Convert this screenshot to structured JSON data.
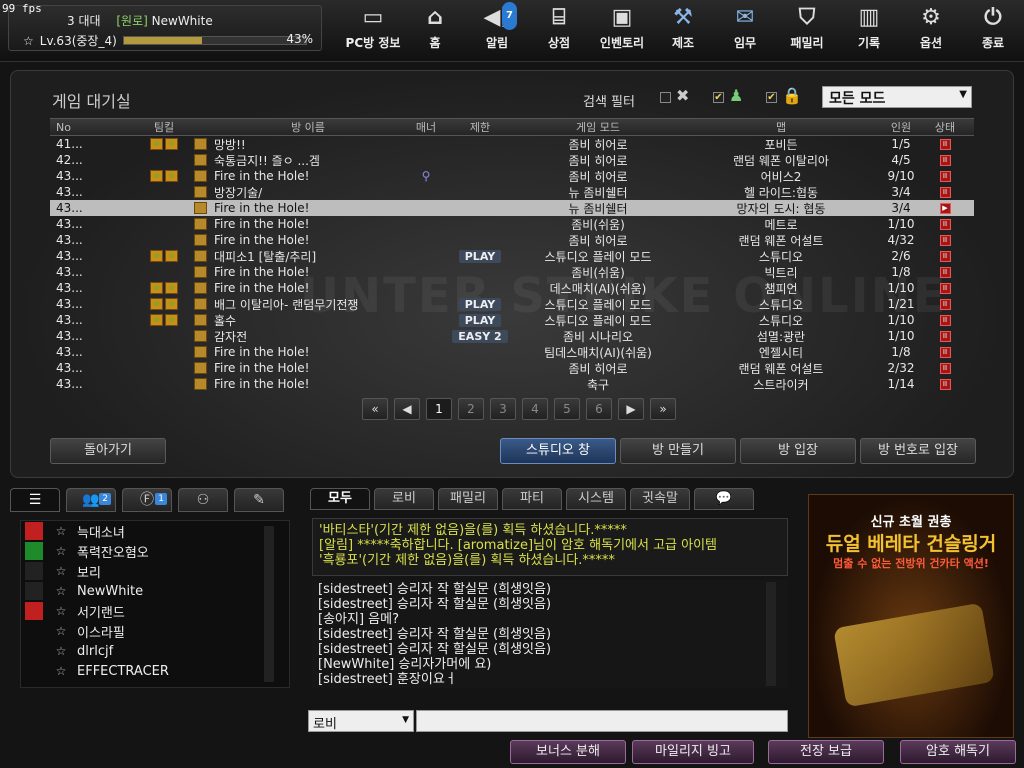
{
  "fps": "99 fps",
  "profile": {
    "clan_label": "3 대대",
    "clan_name": "[원로]",
    "nickname": "NewWhite",
    "level": "Lv.63(중장_4)",
    "xp_percent": "43%",
    "xp_fraction": 0.43
  },
  "nav": [
    {
      "label": "PC방 정보",
      "icon": "monitor-icon"
    },
    {
      "label": "홈",
      "icon": "home-icon"
    },
    {
      "label": "알림",
      "icon": "megaphone-icon",
      "badge": "7"
    },
    {
      "label": "상점",
      "icon": "shop-icon"
    },
    {
      "label": "인벤토리",
      "icon": "briefcase-icon"
    },
    {
      "label": "제조",
      "icon": "craft-icon"
    },
    {
      "label": "임무",
      "icon": "ticket-icon"
    },
    {
      "label": "패밀리",
      "icon": "family-shield-icon"
    },
    {
      "label": "기록",
      "icon": "bar-chart-icon"
    },
    {
      "label": "옵션",
      "icon": "gear-icon"
    },
    {
      "label": "종료",
      "icon": "power-icon"
    }
  ],
  "lobby": {
    "title": "게임 대기실",
    "filter_label": "검색 필터",
    "mode_select": "모든 모드",
    "watermark": "UNTER STRIKE ONLINE",
    "columns": {
      "no": "No",
      "team": "팀킬",
      "name": "방 이름",
      "manner": "매너",
      "limit": "제한",
      "mode": "게임 모드",
      "map": "맵",
      "players": "인원",
      "status": "상태"
    },
    "rooms": [
      {
        "no": "41...",
        "name": "망방!!",
        "tag": "",
        "mode": "좀비 히어로",
        "map": "포비든",
        "players": "1/5"
      },
      {
        "no": "42...",
        "name": "숙통금지!! 즐ㅇ ...겜",
        "tag": "",
        "mode": "좀비 히어로",
        "map": "랜덤 웨폰 이탈리아",
        "players": "4/5"
      },
      {
        "no": "43...",
        "name": "Fire in the Hole!",
        "tag": "",
        "mode": "좀비 히어로",
        "map": "어비스2",
        "players": "9/10"
      },
      {
        "no": "43...",
        "name": "방장기술/",
        "tag": "",
        "mode": "뉴 좀비쉘터",
        "map": "헬 라이드:협동",
        "players": "3/4"
      },
      {
        "no": "43...",
        "name": "Fire in the Hole!",
        "tag": "",
        "mode": "뉴 좀비쉘터",
        "map": "망자의 도시: 협동",
        "players": "3/4"
      },
      {
        "no": "43...",
        "name": "Fire in the Hole!",
        "tag": "",
        "mode": "좀비(쉬움)",
        "map": "메트로",
        "players": "1/10"
      },
      {
        "no": "43...",
        "name": "Fire in the Hole!",
        "tag": "",
        "mode": "좀비 히어로",
        "map": "랜덤 웨폰 어설트",
        "players": "4/32"
      },
      {
        "no": "43...",
        "name": "대피소1 [탈출/추리]",
        "tag": "PLAY",
        "mode": "스튜디오 플레이 모드",
        "map": "스튜디오",
        "players": "2/6"
      },
      {
        "no": "43...",
        "name": "Fire in the Hole!",
        "tag": "",
        "mode": "좀비(쉬움)",
        "map": "빅트리",
        "players": "1/8"
      },
      {
        "no": "43...",
        "name": "Fire in the Hole!",
        "tag": "",
        "mode": "데스매치(AI)(쉬움)",
        "map": "챔피언",
        "players": "1/10"
      },
      {
        "no": "43...",
        "name": "배그 이탈리아- 랜덤무기전쟁",
        "tag": "PLAY",
        "mode": "스튜디오 플레이 모드",
        "map": "스튜디오",
        "players": "1/21"
      },
      {
        "no": "43...",
        "name": "홀수",
        "tag": "PLAY",
        "mode": "스튜디오 플레이 모드",
        "map": "스튜디오",
        "players": "1/10"
      },
      {
        "no": "43...",
        "name": "감자전",
        "tag": "EASY 2",
        "mode": "좀비 시나리오",
        "map": "섬멸:광란",
        "players": "1/10"
      },
      {
        "no": "43...",
        "name": "Fire in the Hole!",
        "tag": "",
        "mode": "팀데스매치(AI)(쉬움)",
        "map": "엔젤시티",
        "players": "1/8"
      },
      {
        "no": "43...",
        "name": "Fire in the Hole!",
        "tag": "",
        "mode": "좀비 히어로",
        "map": "랜덤 웨폰 어설트",
        "players": "2/32"
      },
      {
        "no": "43...",
        "name": "Fire in the Hole!",
        "tag": "",
        "mode": "축구",
        "map": "스트라이커",
        "players": "1/14"
      }
    ],
    "pages": [
      "1",
      "2",
      "3",
      "4",
      "5",
      "6"
    ],
    "current_page": "1",
    "buttons": {
      "back": "돌아가기",
      "studio": "스튜디오 창",
      "create": "방 만들기",
      "enter": "방 입장",
      "enter_by_number": "방 번호로 입장"
    }
  },
  "friends": {
    "tab_badges": {
      "friends": "2",
      "family": "1"
    },
    "list": [
      {
        "name": "늑대소녀",
        "status_icon": "crossed-swords-icon",
        "color": "#c02020"
      },
      {
        "name": "폭력잔오혐오",
        "status_icon": "clover-icon",
        "color": "#1f8a2a"
      },
      {
        "name": "보리",
        "status_icon": "person-icon",
        "color": "#222222"
      },
      {
        "name": "NewWhite",
        "status_icon": "soldier-icon",
        "color": "#222222"
      },
      {
        "name": "서기랜드",
        "status_icon": "skull-icon",
        "color": "#c02020"
      },
      {
        "name": "이스라필",
        "status_icon": "",
        "color": "#0e0e0e"
      },
      {
        "name": "dlrlcjf",
        "status_icon": "phoenix-icon",
        "color": "#0e0e0e"
      },
      {
        "name": "EFFECTRACER",
        "status_icon": "",
        "color": "#0e0e0e"
      }
    ]
  },
  "chat": {
    "tabs": [
      "모두",
      "로비",
      "패밀리",
      "파티",
      "시스템",
      "귓속말"
    ],
    "system_lines": [
      "'바티스타'(기간 제한 없음)을(를) 획득 하셨습니다.*****",
      "[알림] *****축하합니다. [aromatize]님이 암호 해독기에서 고급 아이템",
      "'흑룡포'(기간 제한 없음)을(를) 획득 하셨습니다.*****"
    ],
    "lines": [
      "[sidestreet] 승리자 작 할실문 (희생잇음)",
      "[sidestreet] 승리자 작 할실문 (희생잇음)",
      "[송아지] 음메?",
      "[sidestreet] 승리자 작 할실문 (희생잇음)",
      "[sidestreet] 승리자 작 할실문 (희생잇음)",
      "[NewWhite] 승리자가머에 요)",
      "[sidestreet] 훈장이요ㅓ"
    ],
    "channel": "로비",
    "input_value": ""
  },
  "ad": {
    "line1": "신규 초월 권총",
    "line2": "듀얼 베레타 건슬링거",
    "line3": "멈출 수 없는 전방위 건카타 액션!"
  },
  "bottom_buttons": [
    "보너스 분해",
    "마일리지 빙고",
    "전장 보급",
    "암호 해독기"
  ]
}
